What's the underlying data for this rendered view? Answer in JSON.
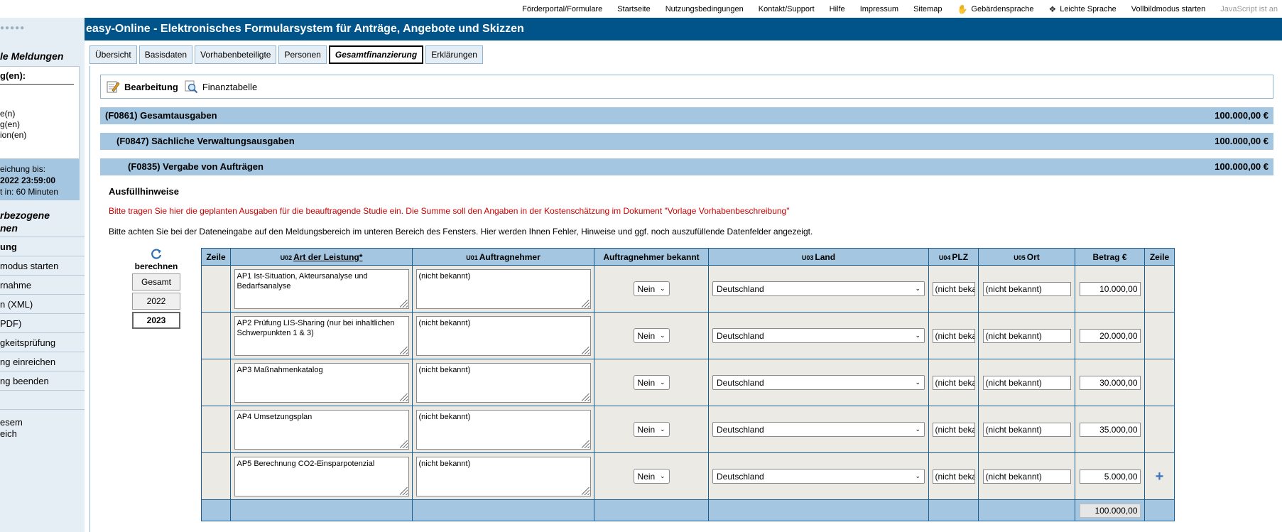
{
  "toplinks": [
    {
      "label": "Förderportal/Formulare",
      "icon": ""
    },
    {
      "label": "Startseite",
      "icon": ""
    },
    {
      "label": "Nutzungsbedingungen",
      "icon": ""
    },
    {
      "label": "Kontakt/Support",
      "icon": ""
    },
    {
      "label": "Hilfe",
      "icon": ""
    },
    {
      "label": "Impressum",
      "icon": ""
    },
    {
      "label": "Sitemap",
      "icon": ""
    },
    {
      "label": "Gebärdensprache",
      "icon": "hand-icon"
    },
    {
      "label": "Leichte Sprache",
      "icon": "book-icon"
    },
    {
      "label": "Vollbildmodus starten",
      "icon": ""
    },
    {
      "label": "JavaScript ist an",
      "icon": ""
    }
  ],
  "sidebar": {
    "heading_meldungen": "le Meldungen",
    "box_title": "g(en):",
    "box_items": [
      "e(n)",
      "g(en)",
      "ion(en)"
    ],
    "frist_lines": [
      "eichung bis:",
      "2022 23:59:00",
      "t in: 60 Minuten"
    ],
    "heading_user": [
      "rbezogene",
      "nen"
    ],
    "menu": [
      {
        "label": "ung",
        "bold": true
      },
      {
        "label": "modus starten",
        "bold": false
      },
      {
        "label": "rnahme",
        "bold": false
      },
      {
        "label": "n (XML)",
        "bold": false
      },
      {
        "label": "PDF)",
        "bold": false
      },
      {
        "label": "gkeitsprüfung",
        "bold": false
      },
      {
        "label": "ng einreichen",
        "bold": false
      },
      {
        "label": "ng beenden",
        "bold": false
      },
      {
        "label": "",
        "bold": false
      }
    ],
    "hint_lines": [
      "esem",
      "eich"
    ]
  },
  "header": {
    "title": "easy-Online - Elektronisches Formularsystem für Anträge, Angebote und Skizzen"
  },
  "tabs": [
    {
      "label": "Übersicht",
      "active": false
    },
    {
      "label": "Basisdaten",
      "active": false
    },
    {
      "label": "Vorhabenbeteiligte",
      "active": false
    },
    {
      "label": "Personen",
      "active": false
    },
    {
      "label": "Gesamtfinanzierung",
      "active": true
    },
    {
      "label": "Erklärungen",
      "active": false
    }
  ],
  "toolbar": {
    "edit_label": "Bearbeitung",
    "finance_label": "Finanztabelle"
  },
  "sections": [
    {
      "label": "(F0861) Gesamtausgaben",
      "amount": "100.000,00 €"
    },
    {
      "label": "(F0847) Sächliche Verwaltungsausgaben",
      "amount": "100.000,00 €"
    },
    {
      "label": "(F0835) Vergabe von Aufträgen",
      "amount": "100.000,00 €"
    }
  ],
  "hints": {
    "title": "Ausfüllhinweise",
    "red": "Bitte tragen Sie hier die geplanten Ausgaben für die beauftragende Studie ein. Die Summe soll den Angaben in der Kostenschätzung im Dokument \"Vorlage Vorhabenbeschreibung\"",
    "black": "Bitte achten Sie bei der Dateneingabe auf den Meldungsbereich im unteren Bereich des Fensters. Hier werden Ihnen Fehler, Hinweise und ggf. noch auszufüllende Datenfelder angezeigt."
  },
  "calc": {
    "label": "berechnen",
    "years": [
      {
        "label": "Gesamt",
        "active": false
      },
      {
        "label": "2022",
        "active": false
      },
      {
        "label": "2023",
        "active": true
      }
    ]
  },
  "table": {
    "headers": {
      "zeile": "Zeile",
      "art_code": "U02",
      "art": "Art der Leistung*",
      "auftragnehmer_code": "U01",
      "auftragnehmer": "Auftragnehmer",
      "bekannt": "Auftragnehmer bekannt",
      "land_code": "U03",
      "land": "Land",
      "plz_code": "U04",
      "plz": "PLZ",
      "ort_code": "U05",
      "ort": "Ort",
      "betrag": "Betrag €",
      "zeile2": "Zeile"
    },
    "rows": [
      {
        "art": "AP1 Ist-Situation, Akteursanalyse und Bedarfsanalyse",
        "auftragnehmer": "(nicht bekannt)",
        "bekannt": "Nein",
        "land": "Deutschland",
        "plz": "(nicht bekannt)",
        "ort": "(nicht bekannt)",
        "betrag": "10.000,00"
      },
      {
        "art": "AP2 Prüfung LIS-Sharing (nur bei inhaltlichen Schwerpunkten 1 & 3)",
        "auftragnehmer": "(nicht bekannt)",
        "bekannt": "Nein",
        "land": "Deutschland",
        "plz": "(nicht bekannt)",
        "ort": "(nicht bekannt)",
        "betrag": "20.000,00"
      },
      {
        "art": "AP3 Maßnahmenkatalog",
        "auftragnehmer": "(nicht bekannt)",
        "bekannt": "Nein",
        "land": "Deutschland",
        "plz": "(nicht bekannt)",
        "ort": "(nicht bekannt)",
        "betrag": "30.000,00"
      },
      {
        "art": "AP4 Umsetzungsplan",
        "auftragnehmer": "(nicht bekannt)",
        "bekannt": "Nein",
        "land": "Deutschland",
        "plz": "(nicht bekannt)",
        "ort": "(nicht bekannt)",
        "betrag": "35.000,00"
      },
      {
        "art": "AP5 Berechnung CO2-Einsparpotenzial",
        "auftragnehmer": "(nicht bekannt)",
        "bekannt": "Nein",
        "land": "Deutschland",
        "plz": "(nicht bekannt)",
        "ort": "(nicht bekannt)",
        "betrag": "5.000,00"
      }
    ],
    "total": "100.000,00"
  },
  "colors": {
    "header_blue": "#00548a",
    "section_blue": "#a4c6e0",
    "hint_red": "#cc0000",
    "add_blue": "#3a73c2"
  }
}
